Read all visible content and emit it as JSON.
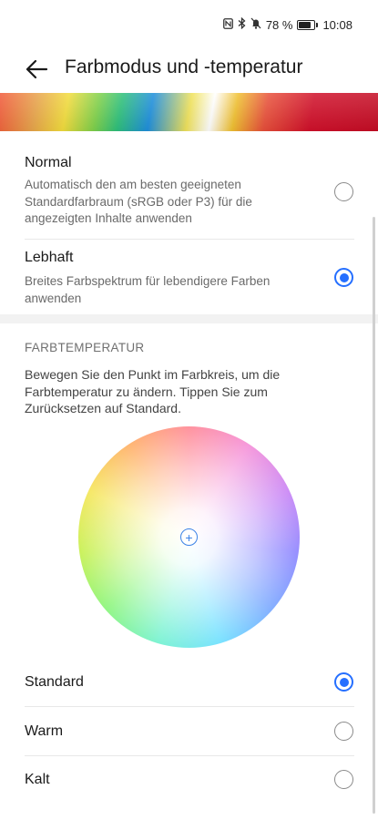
{
  "status_bar": {
    "icons": [
      "nfc-icon",
      "bluetooth-icon",
      "mute-icon"
    ],
    "battery_text": "78 %",
    "battery_level": 0.78,
    "time": "10:08"
  },
  "header": {
    "back_icon": "arrow-left-icon",
    "title": "Farbmodus und -temperatur"
  },
  "color_modes": [
    {
      "title": "Normal",
      "description": "Automatisch den am besten geeigneten Standardfarbraum (sRGB oder P3) für die angezeigten Inhalte anwenden",
      "selected": false
    },
    {
      "title": "Lebhaft",
      "description": "Breites Farbspektrum für lebendigere Farben anwenden",
      "selected": true
    }
  ],
  "temperature": {
    "section_label": "FARBTEMPERATUR",
    "description": "Bewegen Sie den Punkt im Farbkreis, um die Farbtemperatur zu ändern. Tippen Sie zum Zurücksetzen auf Standard.",
    "wheel_marker_symbol": "+",
    "options": [
      {
        "label": "Standard",
        "selected": true
      },
      {
        "label": "Warm",
        "selected": false
      },
      {
        "label": "Kalt",
        "selected": false
      }
    ]
  },
  "colors": {
    "accent": "#256fff",
    "background": "#ffffff",
    "secondary_text": "#6a6a6a"
  }
}
